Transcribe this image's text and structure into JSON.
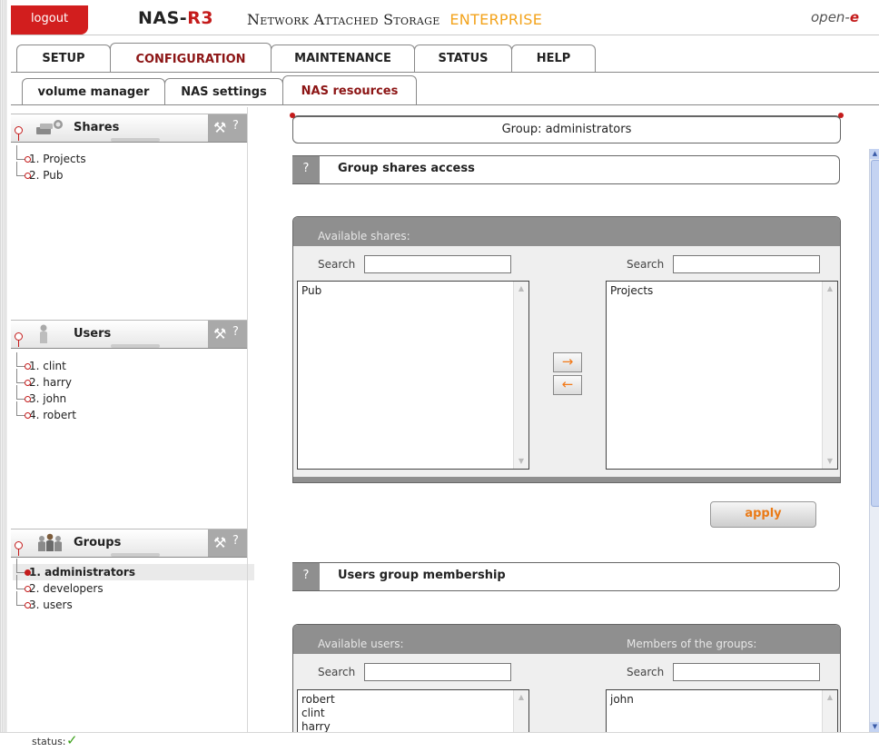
{
  "header": {
    "logout_label": "logout",
    "brand_main": "NAS-",
    "brand_r": "R3",
    "subtitle": "Network Attached Storage",
    "edition": "ENTERPRISE",
    "logo_main": "open-",
    "logo_e": "e"
  },
  "main_tabs": [
    "SETUP",
    "CONFIGURATION",
    "MAINTENANCE",
    "STATUS",
    "HELP"
  ],
  "sub_tabs": [
    "volume manager",
    "NAS settings",
    "NAS resources"
  ],
  "sidebar": {
    "shares": {
      "title": "Shares",
      "help": "?",
      "items": [
        "1. Projects",
        "2. Pub"
      ]
    },
    "users": {
      "title": "Users",
      "help": "?",
      "items": [
        "1. clint",
        "2. harry",
        "3. john",
        "4. robert"
      ]
    },
    "groups": {
      "title": "Groups",
      "help": "?",
      "items": [
        "1. administrators",
        "2. developers",
        "3. users"
      ],
      "selected": "1. administrators"
    }
  },
  "content": {
    "group_title": "Group: administrators",
    "shares_section": {
      "help": "?",
      "title": "Group shares access",
      "available_label": "Available shares:",
      "search_label_left": "Search",
      "search_label_right": "Search",
      "available_items": [
        "Pub"
      ],
      "assigned_items": [
        "Projects"
      ],
      "add_arrow": "→",
      "remove_arrow": "←",
      "apply_label": "apply"
    },
    "users_section": {
      "help": "?",
      "title": "Users group membership",
      "available_label": "Available users:",
      "members_label": "Members of the groups:",
      "search_label_left": "Search",
      "search_label_right": "Search",
      "available_items": [
        "robert",
        "clint",
        "harry"
      ],
      "member_items": [
        "john"
      ]
    }
  },
  "status": {
    "label": "status:",
    "icon": "check-icon",
    "ok_color": "#3aa018"
  },
  "colors": {
    "accent_red": "#c41b1b",
    "accent_orange": "#f3a31c",
    "panel_gray": "#8f8f8f"
  }
}
